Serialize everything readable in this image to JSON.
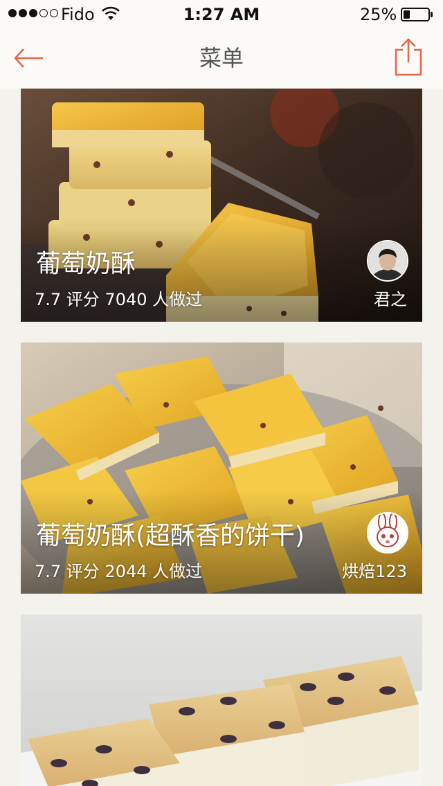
{
  "status_bar": {
    "carrier": "Fido",
    "time": "1:27 AM",
    "battery_percent": "25%",
    "battery_level": 0.25,
    "signal_bars": 3,
    "signal_icon": "signal-dots-icon",
    "wifi_icon": "wifi-icon",
    "battery_icon": "battery-icon"
  },
  "nav": {
    "title": "菜单",
    "back_icon": "arrow-left-icon",
    "share_icon": "share-icon",
    "accent_color": "#e8634a"
  },
  "recipes": [
    {
      "title": "葡萄奶酥",
      "stats": "7.7 评分 7040 人做过",
      "author": "君之",
      "avatar_icon": "avatar-photo-icon"
    },
    {
      "title": "葡萄奶酥(超酥香的饼干)",
      "stats": "7.7 评分 2044 人做过",
      "author": "烘焙123",
      "avatar_icon": "avatar-bunny-icon"
    },
    {
      "title": "",
      "stats": "",
      "author": ""
    }
  ]
}
